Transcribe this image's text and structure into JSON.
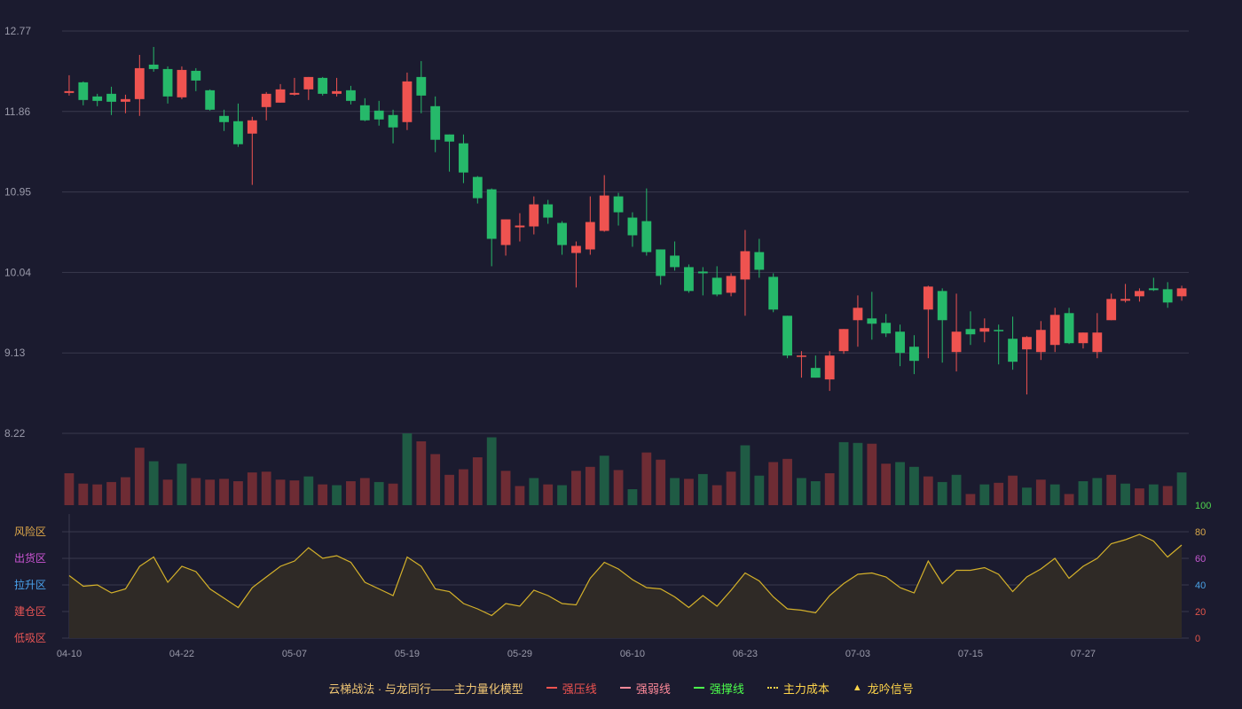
{
  "chart_data": {
    "type": "candlestick",
    "dates": [
      "04-10",
      "04-11",
      "04-14",
      "04-15",
      "04-16",
      "04-17",
      "04-18",
      "04-21",
      "04-22",
      "04-23",
      "04-24",
      "04-25",
      "04-28",
      "04-29",
      "04-30",
      "05-01",
      "05-02",
      "05-05",
      "05-06",
      "05-07",
      "05-08",
      "05-09",
      "05-12",
      "05-13",
      "05-14",
      "05-15",
      "05-16",
      "05-19",
      "05-20",
      "05-21",
      "05-22",
      "05-23",
      "05-26",
      "05-27",
      "05-28",
      "05-29",
      "05-30",
      "06-02",
      "06-03",
      "06-04",
      "06-05",
      "06-06",
      "06-09",
      "06-10",
      "06-11",
      "06-12",
      "06-13",
      "06-16",
      "06-17",
      "06-18",
      "06-19",
      "06-20",
      "06-23",
      "06-24",
      "06-25",
      "06-26",
      "06-27",
      "06-30",
      "07-01",
      "07-02",
      "07-03",
      "07-04",
      "07-07",
      "07-08",
      "07-09",
      "07-10",
      "07-11",
      "07-14",
      "07-15",
      "07-16",
      "07-17",
      "07-18",
      "07-21",
      "07-22",
      "07-23",
      "07-24",
      "07-25",
      "07-28",
      "07-29",
      "07-30",
      "07-31",
      "08-01",
      "08-04",
      "08-05",
      "08-06"
    ],
    "x_tick_labels": [
      "04-10",
      "04-22",
      "05-07",
      "05-19",
      "05-29",
      "06-10",
      "06-23",
      "07-03",
      "07-15",
      "07-27"
    ],
    "x_tick_indices": [
      0,
      8,
      16,
      24,
      32,
      40,
      48,
      56,
      64,
      72
    ],
    "price_axis": {
      "ylim": [
        8.22,
        12.77
      ],
      "tick_labels": [
        "12.77",
        "11.86",
        "10.95",
        "10.04",
        "9.13",
        "8.22"
      ]
    },
    "ohlc": [
      [
        12.07,
        12.09,
        12.27,
        12.04
      ],
      [
        12.19,
        11.99,
        12.2,
        11.93
      ],
      [
        12.03,
        11.98,
        12.06,
        11.92
      ],
      [
        12.06,
        11.97,
        12.14,
        11.82
      ],
      [
        11.97,
        12.0,
        12.05,
        11.84
      ],
      [
        12.0,
        12.35,
        12.5,
        11.81
      ],
      [
        12.39,
        12.34,
        12.59,
        12.31
      ],
      [
        12.34,
        12.03,
        12.37,
        11.95
      ],
      [
        12.02,
        12.33,
        12.37,
        12.0
      ],
      [
        12.32,
        12.21,
        12.35,
        12.09
      ],
      [
        12.1,
        11.88,
        12.11,
        11.87
      ],
      [
        11.81,
        11.74,
        11.88,
        11.64
      ],
      [
        11.75,
        11.49,
        11.95,
        11.46
      ],
      [
        11.61,
        11.76,
        11.8,
        11.03
      ],
      [
        11.91,
        12.06,
        12.08,
        11.76
      ],
      [
        11.96,
        12.11,
        12.17,
        11.96
      ],
      [
        12.05,
        12.07,
        12.24,
        12.04
      ],
      [
        12.11,
        12.25,
        12.25,
        11.99
      ],
      [
        12.24,
        12.06,
        12.25,
        12.04
      ],
      [
        12.06,
        12.09,
        12.24,
        12.03
      ],
      [
        12.1,
        11.98,
        12.15,
        11.94
      ],
      [
        11.93,
        11.76,
        12.01,
        11.75
      ],
      [
        11.87,
        11.77,
        11.98,
        11.7
      ],
      [
        11.82,
        11.68,
        11.88,
        11.5
      ],
      [
        11.74,
        12.2,
        12.3,
        11.65
      ],
      [
        12.25,
        12.04,
        12.43,
        11.84
      ],
      [
        11.92,
        11.54,
        12.03,
        11.4
      ],
      [
        11.6,
        11.52,
        11.6,
        11.18
      ],
      [
        11.5,
        11.17,
        11.6,
        11.05
      ],
      [
        11.12,
        10.88,
        11.13,
        10.82
      ],
      [
        10.98,
        10.42,
        10.99,
        10.11
      ],
      [
        10.35,
        10.64,
        10.64,
        10.23
      ],
      [
        10.55,
        10.57,
        10.71,
        10.39
      ],
      [
        10.56,
        10.81,
        10.9,
        10.47
      ],
      [
        10.81,
        10.66,
        10.86,
        10.59
      ],
      [
        10.6,
        10.35,
        10.62,
        10.24
      ],
      [
        10.26,
        10.34,
        10.39,
        9.87
      ],
      [
        10.3,
        10.61,
        10.9,
        10.24
      ],
      [
        10.51,
        10.91,
        11.14,
        10.5
      ],
      [
        10.9,
        10.72,
        10.94,
        10.57
      ],
      [
        10.66,
        10.46,
        10.72,
        10.33
      ],
      [
        10.62,
        10.27,
        10.99,
        10.23
      ],
      [
        10.3,
        10.0,
        10.3,
        9.9
      ],
      [
        10.23,
        10.1,
        10.39,
        10.06
      ],
      [
        10.1,
        9.83,
        10.13,
        9.81
      ],
      [
        10.05,
        10.03,
        10.1,
        9.78
      ],
      [
        9.98,
        9.79,
        10.11,
        9.77
      ],
      [
        9.81,
        10.0,
        10.03,
        9.77
      ],
      [
        9.96,
        10.28,
        10.52,
        9.55
      ],
      [
        10.27,
        10.07,
        10.42,
        9.98
      ],
      [
        9.99,
        9.62,
        10.03,
        9.59
      ],
      [
        9.55,
        9.1,
        9.55,
        9.07
      ],
      [
        9.1,
        9.1,
        9.15,
        8.85
      ],
      [
        8.96,
        8.85,
        9.1,
        8.85
      ],
      [
        8.83,
        9.1,
        9.15,
        8.7
      ],
      [
        9.15,
        9.4,
        9.4,
        9.12
      ],
      [
        9.5,
        9.64,
        9.78,
        9.2
      ],
      [
        9.52,
        9.46,
        9.82,
        9.28
      ],
      [
        9.47,
        9.35,
        9.57,
        9.31
      ],
      [
        9.37,
        9.13,
        9.45,
        8.98
      ],
      [
        9.2,
        9.04,
        9.33,
        8.89
      ],
      [
        9.62,
        9.88,
        9.89,
        9.07
      ],
      [
        9.83,
        9.5,
        9.86,
        9.02
      ],
      [
        9.14,
        9.37,
        9.8,
        8.92
      ],
      [
        9.4,
        9.34,
        9.6,
        9.22
      ],
      [
        9.37,
        9.41,
        9.52,
        9.25
      ],
      [
        9.39,
        9.38,
        9.45,
        9.0
      ],
      [
        9.29,
        9.03,
        9.54,
        8.94
      ],
      [
        9.17,
        9.31,
        9.32,
        8.66
      ],
      [
        9.14,
        9.39,
        9.49,
        9.05
      ],
      [
        9.22,
        9.56,
        9.64,
        9.14
      ],
      [
        9.58,
        9.24,
        9.64,
        9.23
      ],
      [
        9.24,
        9.36,
        9.36,
        9.18
      ],
      [
        9.14,
        9.36,
        9.58,
        9.07
      ],
      [
        9.5,
        9.74,
        9.8,
        9.5
      ],
      [
        9.72,
        9.74,
        9.91,
        9.7
      ],
      [
        9.77,
        9.83,
        9.86,
        9.71
      ],
      [
        9.86,
        9.84,
        9.98,
        9.83
      ],
      [
        9.85,
        9.7,
        9.93,
        9.64
      ],
      [
        9.77,
        9.86,
        9.89,
        9.72
      ]
    ],
    "up_color": "#ef5350",
    "down_color": "#26b96a",
    "volume": {
      "values": [
        40,
        27,
        26,
        29,
        35,
        72,
        55,
        32,
        52,
        34,
        32,
        33,
        30,
        41,
        42,
        32,
        31,
        36,
        26,
        25,
        30,
        34,
        29,
        27,
        90,
        80,
        64,
        38,
        45,
        60,
        85,
        43,
        24,
        34,
        26,
        25,
        43,
        48,
        62,
        44,
        20,
        66,
        57,
        34,
        33,
        39,
        25,
        42,
        75,
        37,
        54,
        58,
        34,
        30,
        40,
        79,
        78,
        77,
        52,
        54,
        48,
        36,
        29,
        38,
        14,
        26,
        28,
        37,
        22,
        32,
        26,
        14,
        30,
        34,
        38,
        27,
        21,
        26,
        24,
        41
      ],
      "up_flags": [
        1,
        1,
        1,
        1,
        1,
        1,
        0,
        1,
        0,
        1,
        1,
        1,
        1,
        1,
        1,
        1,
        1,
        0,
        1,
        0,
        1,
        1,
        0,
        1,
        0,
        1,
        1,
        1,
        1,
        1,
        0,
        1,
        1,
        0,
        1,
        0,
        1,
        1,
        0,
        1,
        0,
        1,
        1,
        0,
        1,
        0,
        1,
        1,
        0,
        0,
        1,
        1,
        0,
        0,
        1,
        0,
        0,
        1,
        1,
        0,
        0,
        1,
        0,
        0,
        1,
        0,
        1,
        1,
        0,
        1,
        0,
        1,
        0,
        0,
        1,
        0,
        1,
        0,
        1,
        0,
        0
      ],
      "up_color": "#6e2c34",
      "down_color": "#1f5b44"
    },
    "indicator": {
      "values": [
        47,
        39,
        40,
        34,
        37,
        54,
        61,
        42,
        54,
        50,
        37,
        30,
        23,
        38,
        46,
        54,
        58,
        68,
        60,
        62,
        57,
        42,
        37,
        32,
        61,
        54,
        37,
        35,
        26,
        22,
        17,
        26,
        24,
        36,
        32,
        26,
        25,
        45,
        57,
        52,
        44,
        38,
        37,
        31,
        23,
        32,
        24,
        36,
        49,
        43,
        31,
        22,
        21,
        19,
        32,
        41,
        48,
        49,
        46,
        38,
        34,
        58,
        41,
        51,
        51,
        53,
        48,
        35,
        46,
        52,
        60,
        45,
        54,
        60,
        71,
        74,
        78,
        73,
        61,
        70
      ],
      "ylim": [
        0,
        100
      ],
      "right_tick_labels": [
        "100",
        "80",
        "60",
        "40",
        "20",
        "0"
      ],
      "right_tick_colors": [
        "#4fd64f",
        "#d9a84a",
        "#c558d0",
        "#4aa3e8",
        "#e2554a",
        "#e2554a"
      ],
      "zone_labels": [
        "风险区",
        "出货区",
        "拉升区",
        "建仓区",
        "低吸区"
      ],
      "zone_colors": [
        "#e0a94a",
        "#cc55d4",
        "#4aa3ee",
        "#e85555",
        "#e85555"
      ],
      "line_color": "#d4b12a",
      "fill_color": "#2f2a26"
    },
    "legend": [
      {
        "label": "云梯战法 · 与龙同行——主力量化模型",
        "color": "#f0c674",
        "marker": "none"
      },
      {
        "label": "强压线",
        "color": "#ef5350",
        "marker": "solid"
      },
      {
        "label": "强弱线",
        "color": "#ff8a9a",
        "marker": "dashed"
      },
      {
        "label": "强撑线",
        "color": "#4cff4c",
        "marker": "solid"
      },
      {
        "label": "主力成本",
        "color": "#ffd54a",
        "marker": "dotted"
      },
      {
        "label": "龙吟信号",
        "color": "#ffd54a",
        "marker": "triangle"
      }
    ],
    "grid": true,
    "grid_color": "#3a3a4e",
    "axis_text_color": "#9a9aaa"
  }
}
